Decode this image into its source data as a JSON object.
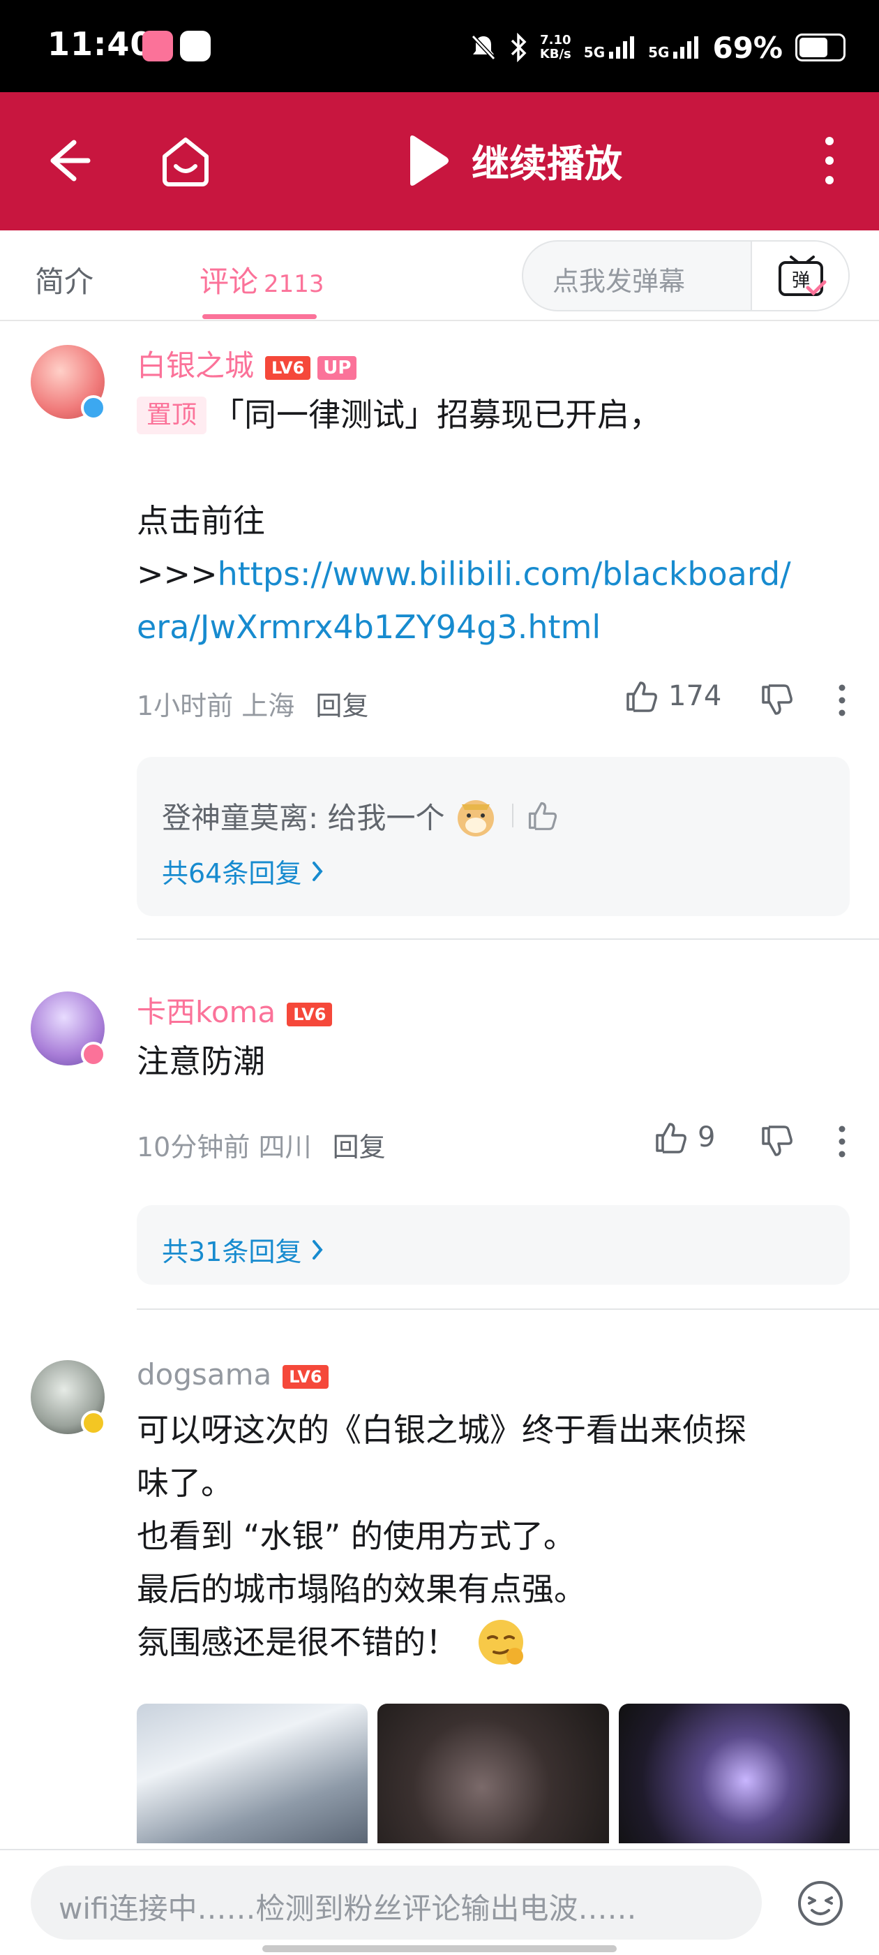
{
  "status_bar": {
    "time": "11:40",
    "net_speed_value": "7.10",
    "net_speed_unit": "KB/s",
    "signal_1": "5G",
    "signal_2": "5G",
    "battery": "69%",
    "battery_level": 0.69
  },
  "header": {
    "back_icon": "arrow-left-icon",
    "home_icon": "tv-home-icon",
    "play_label": "继续播放",
    "more_icon": "more-vertical-icon"
  },
  "tabs": {
    "intro": "简介",
    "comments": "评论",
    "comments_count": "2113",
    "danmaku_placeholder": "点我发弹幕",
    "danmaku_icon_char": "弹"
  },
  "comments": [
    {
      "user": "白银之城",
      "level": "LV6",
      "up_badge": "UP",
      "pin_label": "置顶",
      "text_1": "「同一律测试」招募现已开启，",
      "text_2": "点击前往",
      "text_3_prefix": ">>>",
      "link_line_1": "https://www.bilibili.com/blackboard/",
      "link_line_2": "era/JwXrmrx4b1ZY94g3.html",
      "time": "1小时前",
      "location": "上海",
      "reply_label": "回复",
      "likes": "174",
      "sub_reply_user": "登神童莫离",
      "sub_reply_text": ": 给我一个",
      "reply_total": "共64条回复",
      "avatar_color": "#f07a7a"
    },
    {
      "user": "卡西koma",
      "level": "LV6",
      "text_1": "注意防潮",
      "time": "10分钟前",
      "location": "四川",
      "reply_label": "回复",
      "likes": "9",
      "reply_total": "共31条回复",
      "avatar_color": "#a97ed8"
    },
    {
      "user": "dogsama",
      "level": "LV6",
      "text_1": "可以呀这次的《白银之城》终于看出来侦探",
      "text_2": "味了。",
      "text_3": "也看到 “水银” 的使用方式了。",
      "text_4": "最后的城市塌陷的效果有点强。",
      "text_5": "氛围感还是很不错的！",
      "avatar_color": "#9aa29b"
    }
  ],
  "bottom_bar": {
    "input_placeholder": "wifi连接中……检测到粉丝评论输出电波……",
    "emoji_icon": "emoji-face-icon"
  },
  "colors": {
    "header_red": "#c8163f",
    "pink": "#fb7299",
    "link_blue": "#178bcf"
  }
}
